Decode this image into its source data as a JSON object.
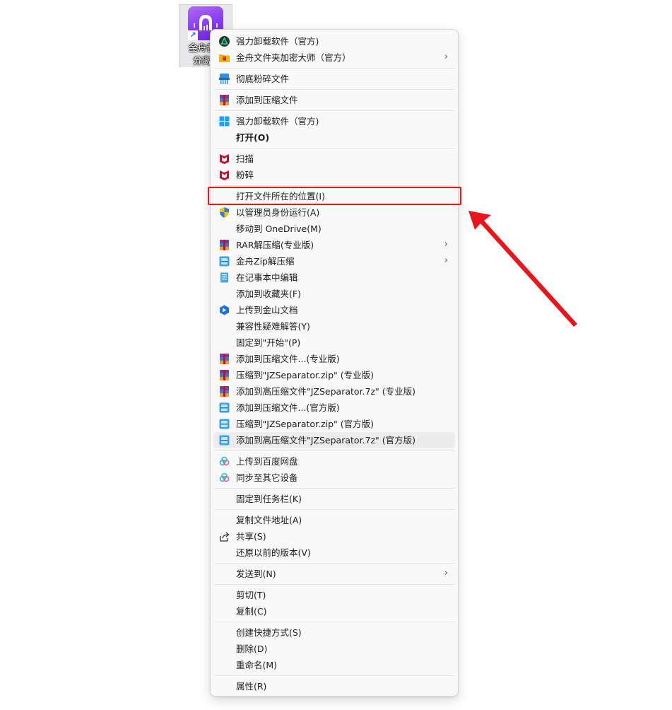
{
  "desktop": {
    "icon_label": "金舟音频\n分离器",
    "shortcut_glyph": "↗"
  },
  "menu": {
    "items": [
      {
        "label": "强力卸载软件（官方)",
        "icon": "uninstall-icon"
      },
      {
        "label": "金舟文件夹加密大师（官方）",
        "icon": "folder-lock-icon",
        "chevron": "›"
      },
      {
        "label": "彻底粉碎文件",
        "icon": "shredder-icon"
      },
      {
        "label": "添加到压缩文件",
        "icon": "winrar-icon"
      },
      {
        "label": "强力卸载软件（官方)",
        "icon": "windows-icon"
      },
      {
        "label": "打开(O)",
        "bold": true
      },
      {
        "label": "扫描",
        "icon": "mcafee-icon"
      },
      {
        "label": "粉碎",
        "icon": "mcafee-icon"
      },
      {
        "label": "打开文件所在的位置(I)"
      },
      {
        "label": "以管理员身份运行(A)",
        "icon": "shield-icon"
      },
      {
        "label": "移动到 OneDrive(M)"
      },
      {
        "label": "RAR解压缩(专业版)",
        "icon": "winrar-icon",
        "chevron": "›"
      },
      {
        "label": "金舟Zip解压缩",
        "icon": "zip-icon",
        "chevron": "›"
      },
      {
        "label": "在记事本中编辑",
        "icon": "notepad-icon"
      },
      {
        "label": "添加到收藏夹(F)"
      },
      {
        "label": "上传到金山文档",
        "icon": "kdocs-icon"
      },
      {
        "label": "兼容性疑难解答(Y)"
      },
      {
        "label": "固定到\"开始\"(P)"
      },
      {
        "label": "添加到压缩文件...(专业版)",
        "icon": "winrar-icon"
      },
      {
        "label": "压缩到\"JZSeparator.zip\" (专业版)",
        "icon": "winrar-icon"
      },
      {
        "label": "添加到高压缩文件\"JZSeparator.7z\" (专业版)",
        "icon": "winrar-icon"
      },
      {
        "label": "添加到压缩文件...(官方版)",
        "icon": "zip-icon"
      },
      {
        "label": "压缩到\"JZSeparator.zip\" (官方版)",
        "icon": "zip-icon"
      },
      {
        "label": "添加到高压缩文件\"JZSeparator.7z\" (官方版)",
        "icon": "zip-icon"
      },
      {
        "label": "上传到百度网盘",
        "icon": "baidu-cloud-icon"
      },
      {
        "label": "同步至其它设备",
        "icon": "baidu-cloud-icon"
      },
      {
        "label": "固定到任务栏(K)"
      },
      {
        "label": "复制文件地址(A)"
      },
      {
        "label": "共享(S)",
        "icon": "share-icon"
      },
      {
        "label": "还原以前的版本(V)"
      },
      {
        "label": "发送到(N)",
        "chevron": "›"
      },
      {
        "label": "剪切(T)"
      },
      {
        "label": "复制(C)"
      },
      {
        "label": "创建快捷方式(S)"
      },
      {
        "label": "删除(D)"
      },
      {
        "label": "重命名(M)"
      },
      {
        "label": "属性(R)"
      }
    ]
  },
  "colors": {
    "annotation_red": "#e8151b",
    "menu_background": "#f9f9f9",
    "hover_background": "#ececec"
  }
}
